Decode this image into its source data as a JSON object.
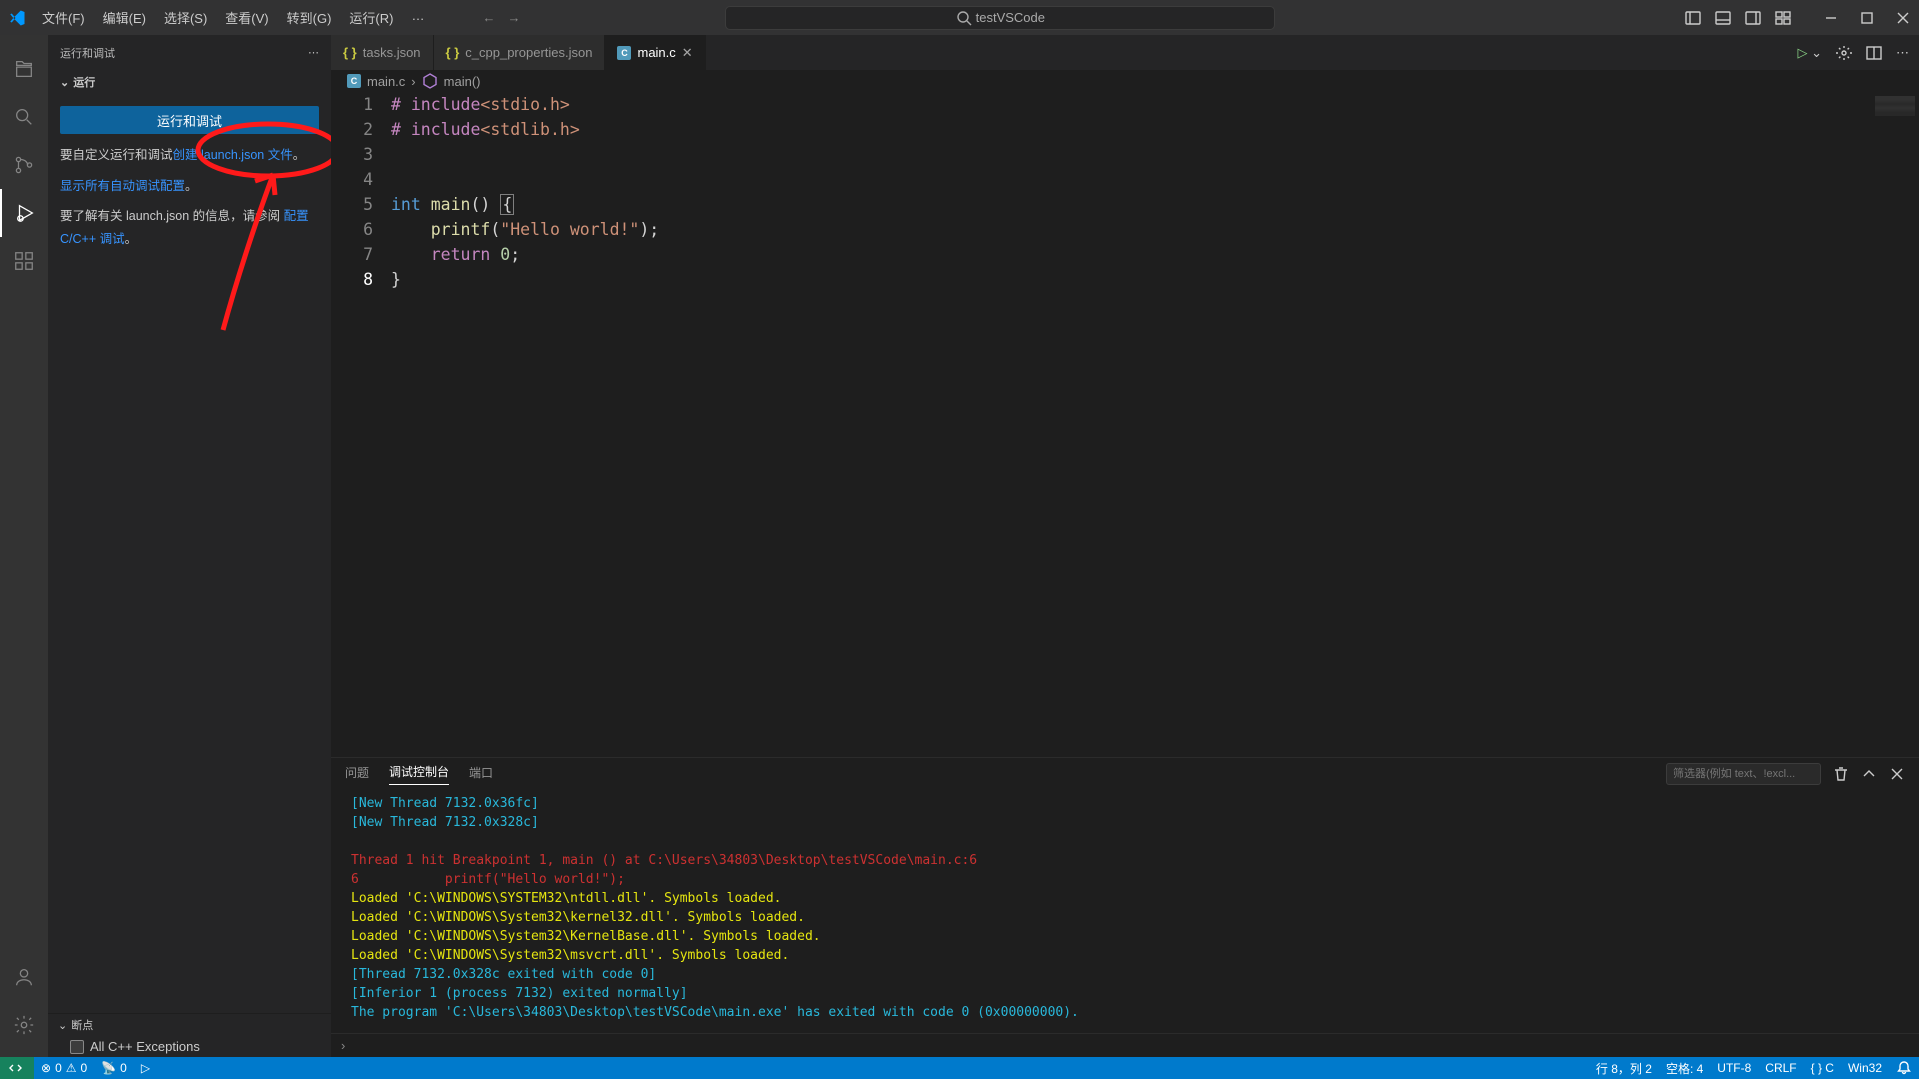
{
  "title": "testVSCode",
  "menu": [
    "文件(F)",
    "编辑(E)",
    "选择(S)",
    "查看(V)",
    "转到(G)",
    "运行(R)",
    "…"
  ],
  "sidebar": {
    "title": "运行和调试",
    "section": "运行",
    "run_btn": "运行和调试",
    "hint1_prefix": "要自定义运行和调试",
    "hint1_link": "创建 launch.json 文件",
    "hint1_suffix": "。",
    "hint2_link": "显示所有自动调试配置",
    "hint2_suffix": "。",
    "hint3_prefix": "要了解有关 launch.json 的信息，请参阅 ",
    "hint3_link": "配置 C/C++ 调试",
    "hint3_suffix": "。",
    "breakpoints_label": "断点",
    "bp_item": "All C++ Exceptions"
  },
  "tabs": [
    {
      "name": "tasks.json",
      "icon": "json",
      "active": false
    },
    {
      "name": "c_cpp_properties.json",
      "icon": "json",
      "active": false
    },
    {
      "name": "main.c",
      "icon": "c",
      "active": true
    }
  ],
  "breadcrumb": {
    "file": "main.c",
    "symbol": "main()"
  },
  "editor": {
    "lines": [
      {
        "n": 1,
        "tokens": [
          {
            "t": "# ",
            "c": "tk-pre"
          },
          {
            "t": "include",
            "c": "tk-pre"
          },
          {
            "t": "<stdio.h>",
            "c": "tk-hdr"
          }
        ]
      },
      {
        "n": 2,
        "tokens": [
          {
            "t": "# ",
            "c": "tk-pre"
          },
          {
            "t": "include",
            "c": "tk-pre"
          },
          {
            "t": "<stdlib.h>",
            "c": "tk-hdr"
          }
        ]
      },
      {
        "n": 3,
        "tokens": []
      },
      {
        "n": 4,
        "tokens": []
      },
      {
        "n": 5,
        "tokens": [
          {
            "t": "int ",
            "c": "tk-kw"
          },
          {
            "t": "main",
            "c": "tk-fn"
          },
          {
            "t": "() ",
            "c": "tk-punc"
          },
          {
            "t": "{",
            "c": "tk-punc",
            "boxed": true
          }
        ]
      },
      {
        "n": 6,
        "tokens": [
          {
            "t": "    ",
            "c": ""
          },
          {
            "t": "printf",
            "c": "tk-fn"
          },
          {
            "t": "(",
            "c": "tk-punc"
          },
          {
            "t": "\"Hello world!\"",
            "c": "tk-str"
          },
          {
            "t": ");",
            "c": "tk-punc"
          }
        ]
      },
      {
        "n": 7,
        "tokens": [
          {
            "t": "    ",
            "c": ""
          },
          {
            "t": "return ",
            "c": "tk-pre"
          },
          {
            "t": "0",
            "c": "tk-num"
          },
          {
            "t": ";",
            "c": "tk-punc"
          }
        ]
      },
      {
        "n": 8,
        "tokens": [
          {
            "t": "}",
            "c": "tk-punc"
          }
        ],
        "current": true
      }
    ]
  },
  "panel": {
    "tabs": [
      "问题",
      "调试控制台",
      "端口"
    ],
    "active": 1,
    "filter_placeholder": "筛选器(例如 text、!excl...",
    "lines": [
      {
        "t": "[New Thread 7132.0x36fc]",
        "c": "c-cyan"
      },
      {
        "t": "[New Thread 7132.0x328c]",
        "c": "c-cyan"
      },
      {
        "t": "",
        "c": ""
      },
      {
        "t": "Thread 1 hit Breakpoint 1, main () at C:\\Users\\34803\\Desktop\\testVSCode\\main.c:6",
        "c": "c-red"
      },
      {
        "t": "6           printf(\"Hello world!\");",
        "c": "c-red"
      },
      {
        "t": "Loaded 'C:\\WINDOWS\\SYSTEM32\\ntdll.dll'. Symbols loaded.",
        "c": "c-yellow"
      },
      {
        "t": "Loaded 'C:\\WINDOWS\\System32\\kernel32.dll'. Symbols loaded.",
        "c": "c-yellow"
      },
      {
        "t": "Loaded 'C:\\WINDOWS\\System32\\KernelBase.dll'. Symbols loaded.",
        "c": "c-yellow"
      },
      {
        "t": "Loaded 'C:\\WINDOWS\\System32\\msvcrt.dll'. Symbols loaded.",
        "c": "c-yellow"
      },
      {
        "t": "[Thread 7132.0x328c exited with code 0]",
        "c": "c-cyan"
      },
      {
        "t": "[Inferior 1 (process 7132) exited normally]",
        "c": "c-cyan"
      },
      {
        "t": "The program 'C:\\Users\\34803\\Desktop\\testVSCode\\main.exe' has exited with code 0 (0x00000000).",
        "c": "c-cyan"
      }
    ]
  },
  "status": {
    "errors": "0",
    "warnings": "0",
    "ports": "0",
    "pos": "行 8，列 2",
    "spaces": "空格: 4",
    "encoding": "UTF-8",
    "eol": "CRLF",
    "lang": "{ }  C",
    "platform": "Win32"
  }
}
